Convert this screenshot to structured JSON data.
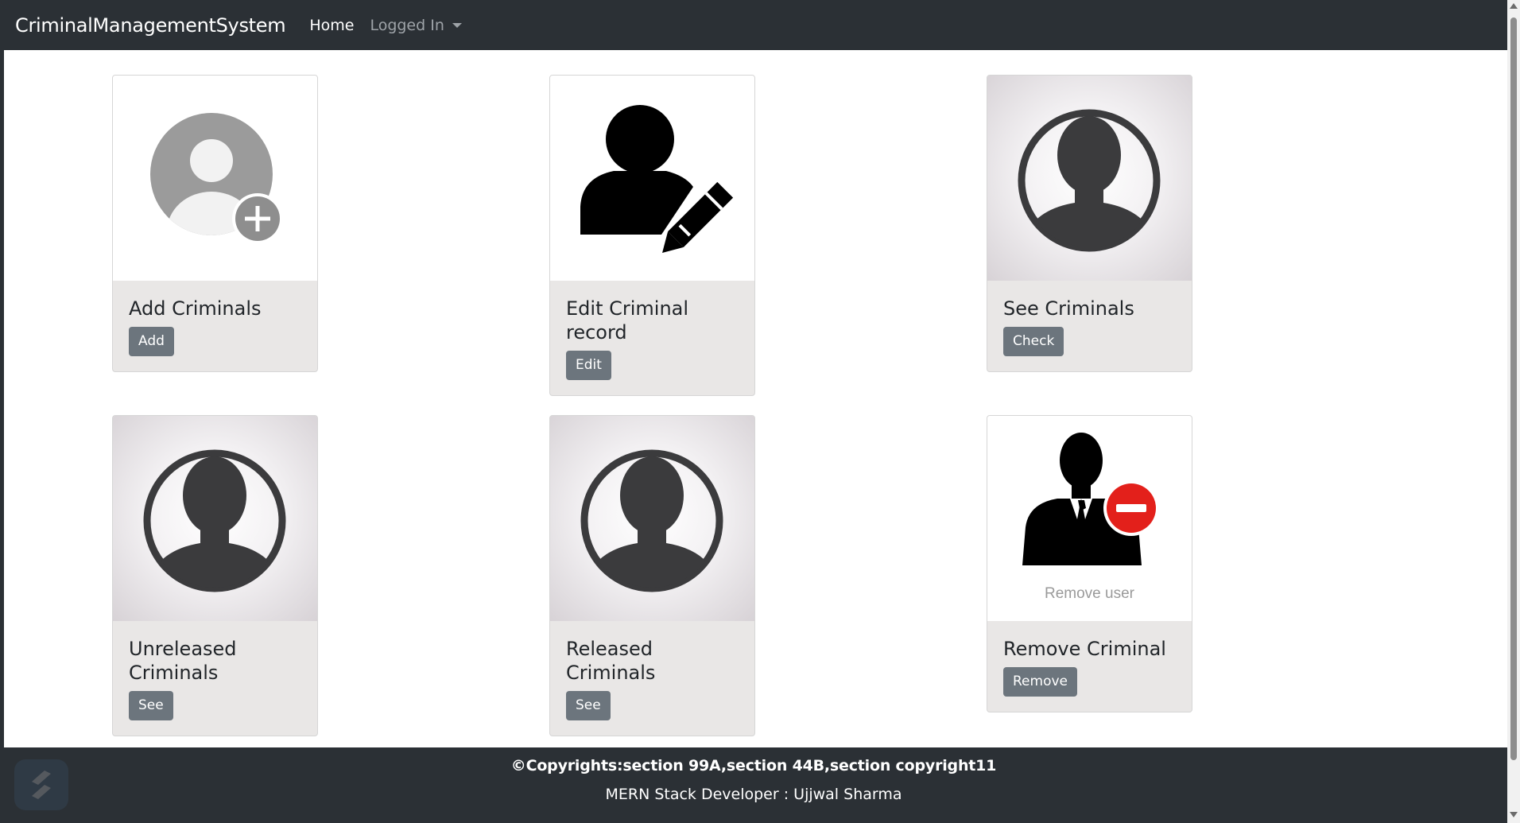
{
  "navbar": {
    "brand": "CriminalManagementSystem",
    "home_label": "Home",
    "dropdown_label": "Logged In"
  },
  "cards": [
    {
      "title": "Add Criminals",
      "button": "Add",
      "image": "add-user-icon"
    },
    {
      "title": "Edit Criminal record",
      "button": "Edit",
      "image": "edit-user-icon"
    },
    {
      "title": "See Criminals",
      "button": "Check",
      "image": "user-avatar-icon"
    },
    {
      "title": "Unreleased Criminals",
      "button": "See",
      "image": "user-avatar-icon"
    },
    {
      "title": "Released Criminals",
      "button": "See",
      "image": "user-avatar-icon"
    },
    {
      "title": "Remove Criminal",
      "button": "Remove",
      "image": "remove-user-icon",
      "image_caption": "Remove user"
    }
  ],
  "footer": {
    "copyright": "©Copyrights:section 99A,section 44B,section copyright11",
    "developer": "MERN Stack Developer : Ujjwal Sharma"
  },
  "colors": {
    "navbar_bg": "#2b3035",
    "button_bg": "#6c757d",
    "card_body_bg": "#e9e7e6",
    "remove_badge": "#e3201b"
  }
}
